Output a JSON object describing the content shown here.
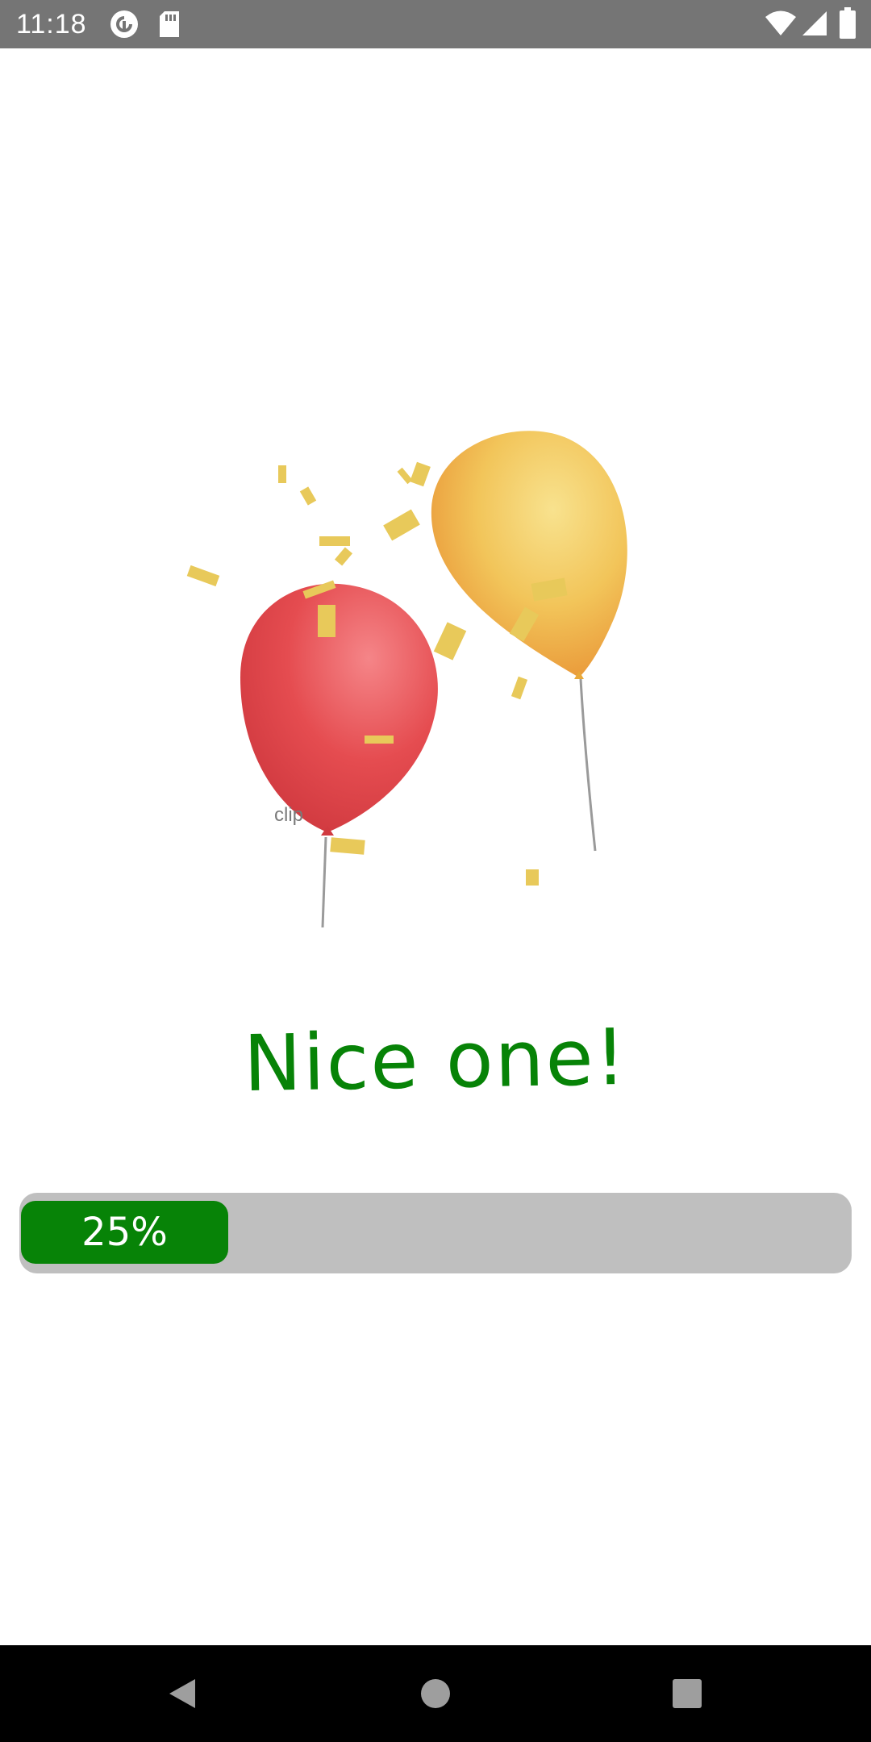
{
  "status_bar": {
    "time": "11:18",
    "icons": [
      "pocket-casts-icon",
      "sd-card-icon",
      "wifi-icon",
      "signal-icon",
      "battery-icon"
    ]
  },
  "illustration": {
    "watermark": "clip",
    "balloons": [
      {
        "name": "red-balloon",
        "color": "#e2494d"
      },
      {
        "name": "yellow-balloon",
        "color": "#f2c55a"
      }
    ],
    "confetti_color": "#e8c95a"
  },
  "message": {
    "text": "Nice one!",
    "color": "#078307"
  },
  "progress": {
    "label": "25%",
    "value": 0.25,
    "fill_color": "#078307",
    "track_color": "#bfbfbf"
  },
  "nav_bar": {
    "buttons": [
      "back-icon",
      "home-icon",
      "recents-icon"
    ]
  }
}
